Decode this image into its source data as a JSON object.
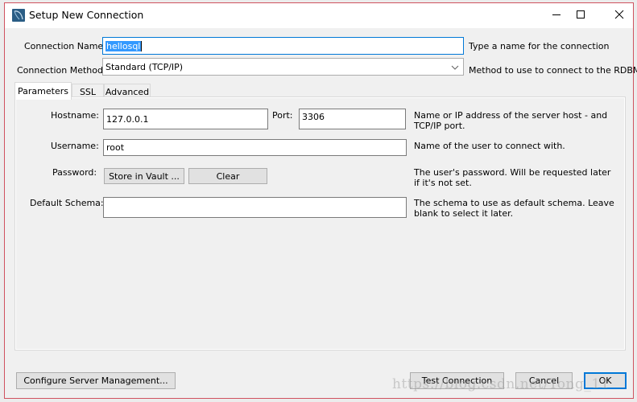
{
  "window": {
    "title": "Setup New Connection",
    "controls": {
      "minimize": "minimize",
      "maximize": "maximize",
      "close": "close"
    }
  },
  "connection": {
    "name_label": "Connection Name:",
    "name_value": "hellosql",
    "name_hint": "Type a name for the connection",
    "method_label": "Connection Method:",
    "method_value": "Standard (TCP/IP)",
    "method_hint": "Method to use to connect to the RDBMS"
  },
  "tabs": [
    {
      "label": "Parameters",
      "active": true
    },
    {
      "label": "SSL",
      "active": false
    },
    {
      "label": "Advanced",
      "active": false
    }
  ],
  "parameters": {
    "hostname_label": "Hostname:",
    "hostname_value": "127.0.0.1",
    "port_label": "Port:",
    "port_value": "3306",
    "host_hint": "Name or IP address of the server host - and TCP/IP port.",
    "username_label": "Username:",
    "username_value": "root",
    "username_hint": "Name of the user to connect with.",
    "password_label": "Password:",
    "store_vault_label": "Store in Vault ...",
    "clear_label": "Clear",
    "password_hint": "The user's password. Will be requested later if it's not set.",
    "schema_label": "Default Schema:",
    "schema_value": "",
    "schema_hint": "The schema to use as default schema. Leave blank to select it later."
  },
  "footer": {
    "configure_label": "Configure Server Management...",
    "test_label": "Test Connection",
    "cancel_label": "Cancel",
    "ok_label": "OK"
  },
  "watermark": "https://blog.csdn.net/Tong_11",
  "colors": {
    "accent": "#0078d7",
    "window_border": "#d0525f",
    "selection": "#3399ff"
  }
}
